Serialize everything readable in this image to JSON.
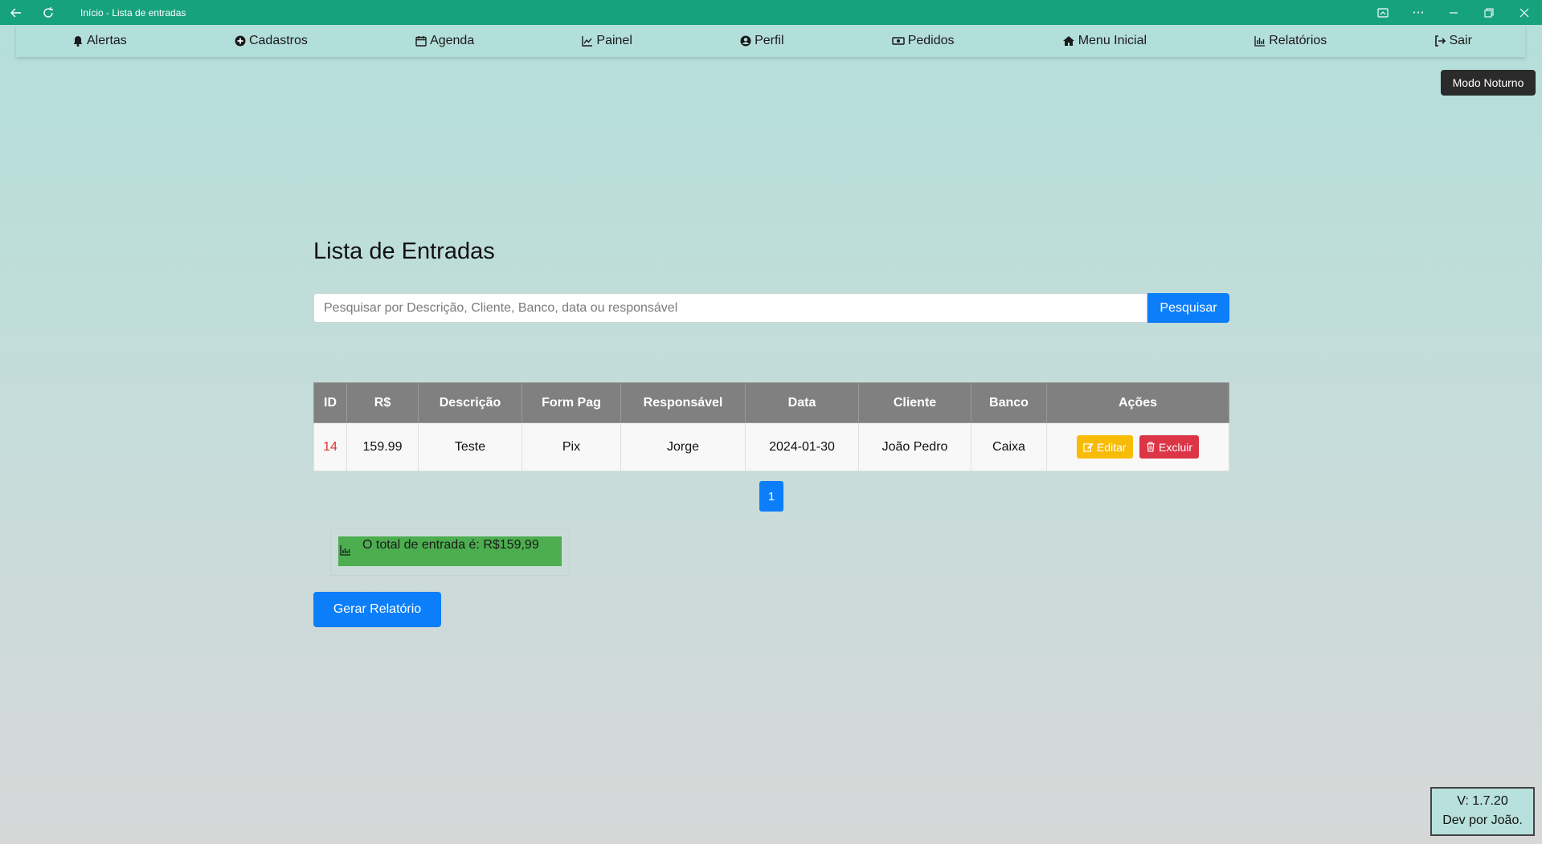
{
  "window": {
    "title": "Início - Lista de entradas"
  },
  "nav": {
    "items": [
      {
        "label": "Alertas",
        "icon": "bell-icon"
      },
      {
        "label": "Cadastros",
        "icon": "plus-circle-icon"
      },
      {
        "label": "Agenda",
        "icon": "calendar-icon"
      },
      {
        "label": "Painel",
        "icon": "line-chart-icon"
      },
      {
        "label": "Perfil",
        "icon": "user-circle-icon"
      },
      {
        "label": "Pedidos",
        "icon": "money-bill-icon"
      },
      {
        "label": "Menu Inicial",
        "icon": "home-icon"
      },
      {
        "label": "Relatórios",
        "icon": "bar-chart-icon"
      },
      {
        "label": "Sair",
        "icon": "sign-out-icon"
      }
    ]
  },
  "modo_noturno_label": "Modo Noturno",
  "page_title": "Lista de Entradas",
  "search": {
    "placeholder": "Pesquisar por Descrição, Cliente, Banco, data ou responsável",
    "value": "",
    "button_label": "Pesquisar"
  },
  "table": {
    "headers": [
      "ID",
      "R$",
      "Descrição",
      "Form Pag",
      "Responsável",
      "Data",
      "Cliente",
      "Banco",
      "Ações"
    ],
    "rows": [
      {
        "id": "14",
        "valor": "159.99",
        "descricao": "Teste",
        "form_pag": "Pix",
        "responsavel": "Jorge",
        "data": "2024-01-30",
        "cliente": "João Pedro",
        "banco": "Caixa"
      }
    ],
    "edit_label": "Editar",
    "delete_label": "Excluir"
  },
  "pagination": {
    "current": "1"
  },
  "total_text": "O total de entrada é: R$159,99",
  "gerar_relatorio_label": "Gerar Relatório",
  "version": {
    "line1": "V: 1.7.20",
    "line2": "Dev por João."
  },
  "colors": {
    "titlebar": "#17a27e",
    "primary": "#0d7ef9",
    "warning": "#f8bc07",
    "danger": "#dc3545",
    "success": "#4cae4f"
  }
}
